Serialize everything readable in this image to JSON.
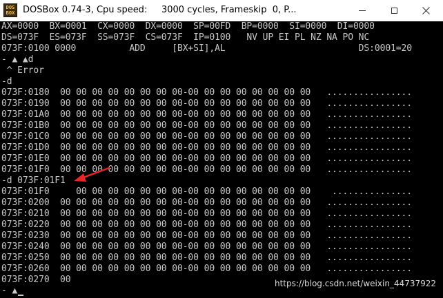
{
  "window": {
    "title": "DOSBox 0.74-3, Cpu speed:     3000 cycles, Frameskip  0, P...",
    "icon_text_top": "DOS",
    "icon_text_bottom": "BOX",
    "controls": {
      "minimize": "minimize-icon",
      "maximize": "maximize-icon",
      "close": "close-icon"
    }
  },
  "console": {
    "lines": [
      "AX=0000  BX=0001  CX=0000  DX=0000  SP=00FD  BP=0000  SI=0000  DI=0000",
      "DS=073F  ES=073F  SS=073F  CS=073F  IP=0100   NV UP EI PL NZ NA PO NC",
      "073F:0100 0000          ADD     [BX+SI],AL                         DS:0001=20",
      "- ▲ ▲d",
      " ^ Error",
      "-d",
      "073F:0180  00 00 00 00 00 00 00 00-00 00 00 00 00 00 00 00   ................",
      "073F:0190  00 00 00 00 00 00 00 00-00 00 00 00 00 00 00 00   ................",
      "073F:01A0  00 00 00 00 00 00 00 00-00 00 00 00 00 00 00 00   ................",
      "073F:01B0  00 00 00 00 00 00 00 00-00 00 00 00 00 00 00 00   ................",
      "073F:01C0  00 00 00 00 00 00 00 00-00 00 00 00 00 00 00 00   ................",
      "073F:01D0  00 00 00 00 00 00 00 00-00 00 00 00 00 00 00 00   ................",
      "073F:01E0  00 00 00 00 00 00 00 00-00 00 00 00 00 00 00 00   ................",
      "073F:01F0  00 00 00 00 00 00 00 00-00 00 00 00 00 00 00 00   ................",
      "-d 073F:01F1",
      "073F:01F0     00 00 00 00 00 00 00-00 00 00 00 00 00 00 00    ...............",
      "073F:0200  00 00 00 00 00 00 00 00-00 00 00 00 00 00 00 00   ................",
      "073F:0210  00 00 00 00 00 00 00 00-00 00 00 00 00 00 00 00   ................",
      "073F:0220  00 00 00 00 00 00 00 00-00 00 00 00 00 00 00 00   ................",
      "073F:0230  00 00 00 00 00 00 00 00-00 00 00 00 00 00 00 00   ................",
      "073F:0240  00 00 00 00 00 00 00 00-00 00 00 00 00 00 00 00   ................",
      "073F:0250  00 00 00 00 00 00 00 00-00 00 00 00 00 00 00 00   ................",
      "073F:0260  00 00 00 00 00 00 00 00-00 00 00 00 00 00 00 00   ................",
      "073F:0270  00",
      "- ▲"
    ],
    "text_color": "#c8c8c8",
    "background_color": "#000000"
  },
  "annotation": {
    "arrow": "red-arrow-icon",
    "color": "#e8262a"
  },
  "watermark": {
    "text": "https://blog.csdn.net/weixin_44737922"
  }
}
